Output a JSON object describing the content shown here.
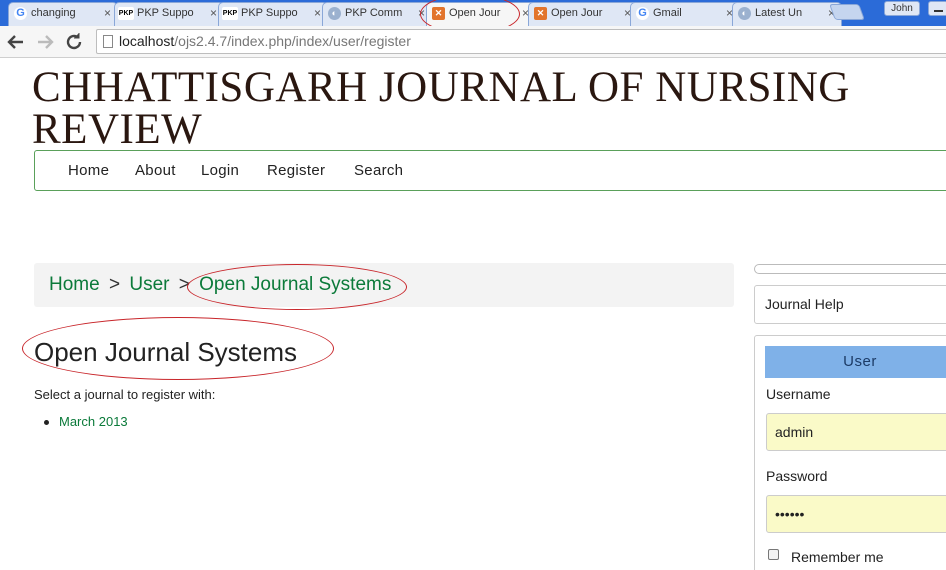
{
  "browser": {
    "tabs": [
      {
        "label": "changing",
        "icon": "google-icon"
      },
      {
        "label": "PKP Suppo",
        "icon": "pkp-icon"
      },
      {
        "label": "PKP Suppo",
        "icon": "pkp-icon"
      },
      {
        "label": "PKP Comm",
        "icon": "pkp-community-icon"
      },
      {
        "label": "Open Jour",
        "icon": "ojs-icon",
        "active": true
      },
      {
        "label": "Open Jour",
        "icon": "ojs-icon"
      },
      {
        "label": "Gmail",
        "icon": "google-icon"
      },
      {
        "label": "Latest Un",
        "icon": "pkp-community-icon"
      }
    ],
    "user": "John",
    "url_host": "localhost",
    "url_path": "/ojs2.4.7/index.php/index/user/register",
    "close_glyph": "×",
    "icons": {
      "g": "G",
      "pkp": "PKP",
      "ojs": "✕",
      "comm": "◐"
    }
  },
  "site": {
    "title": "CHHATTISGARH JOURNAL OF NURSING REVIEW",
    "nav": [
      "Home",
      "About",
      "Login",
      "Register",
      "Search"
    ]
  },
  "breadcrumb": {
    "items": [
      "Home",
      "User",
      "Open Journal Systems"
    ],
    "separator": ">"
  },
  "main": {
    "heading": "Open Journal Systems",
    "intro": "Select a journal to register with:",
    "journals": [
      "March 2013"
    ]
  },
  "sidebar": {
    "help_label": "Journal Help",
    "user_header": "User",
    "username_label": "Username",
    "username_value": "admin",
    "password_label": "Password",
    "password_value": "••••••",
    "remember_label": "Remember me"
  },
  "colors": {
    "link": "#0b7a3a",
    "annotation": "#c8262b",
    "nav_border": "#5aa05a",
    "user_header": "#7fb1e8",
    "input_bg": "#fafac8"
  }
}
